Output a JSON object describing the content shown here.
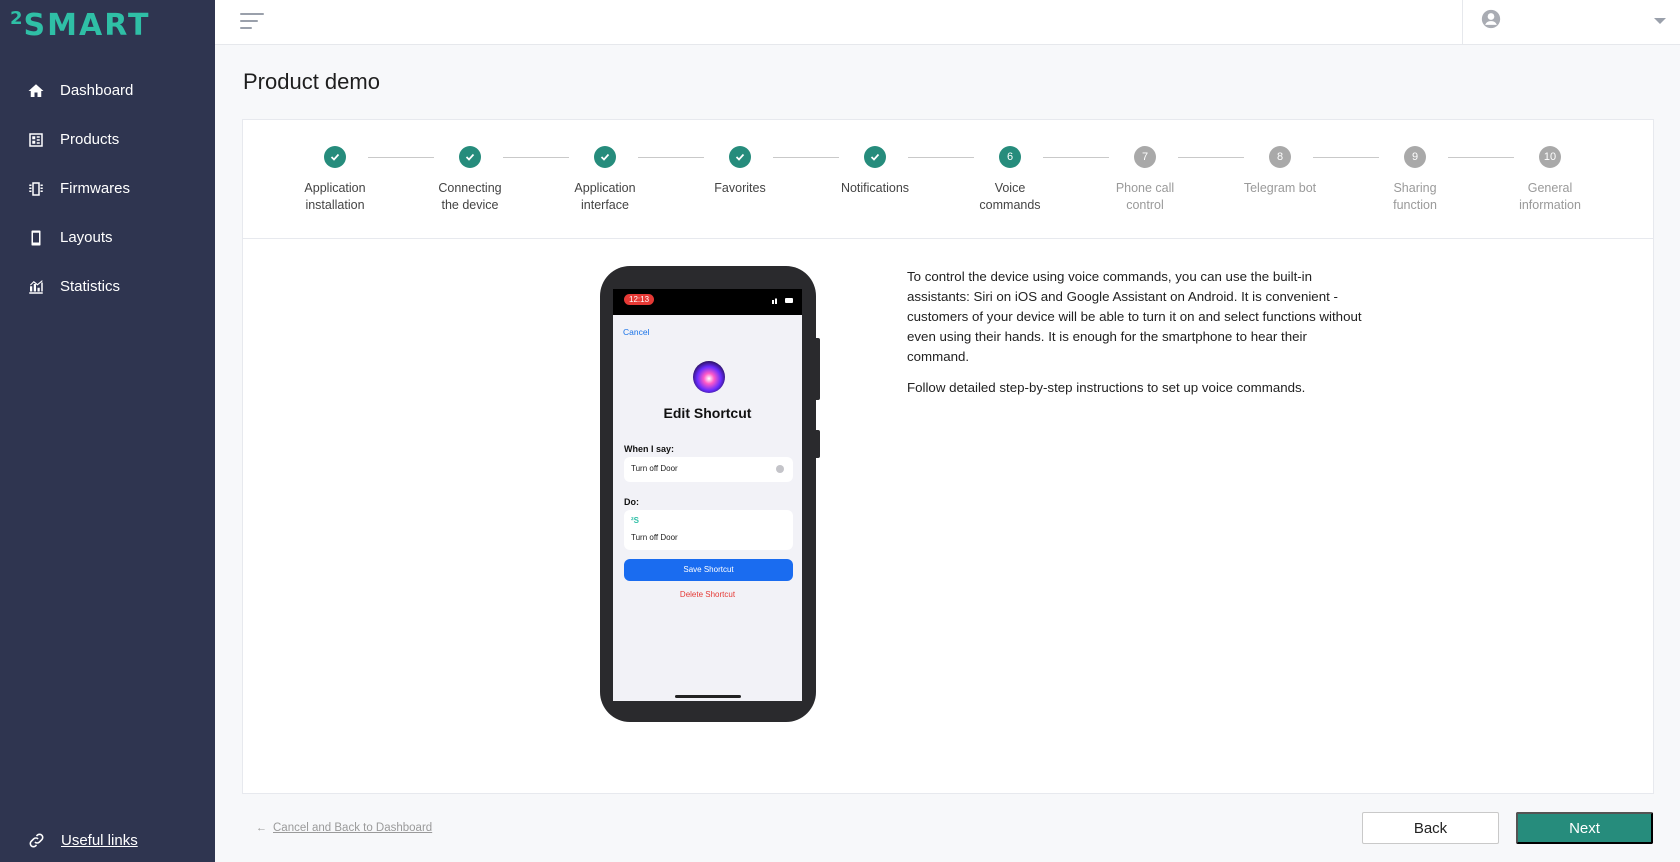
{
  "brand": {
    "logo_sup": "2",
    "logo_text": "SMART",
    "accent": "#268c7c",
    "logo_color": "#2fbfa6"
  },
  "sidebar": {
    "items": [
      {
        "label": "Dashboard",
        "icon": "home-icon"
      },
      {
        "label": "Products",
        "icon": "products-icon"
      },
      {
        "label": "Firmwares",
        "icon": "firmware-icon"
      },
      {
        "label": "Layouts",
        "icon": "phone-icon"
      },
      {
        "label": "Statistics",
        "icon": "statistics-icon"
      }
    ],
    "useful_links": "Useful links"
  },
  "header": {
    "user_icon": "user-icon",
    "menu_icon": "menu-icon"
  },
  "page": {
    "title": "Product demo"
  },
  "steps": [
    {
      "number": "1",
      "line1": "Application",
      "line2": "installation",
      "state": "done"
    },
    {
      "number": "2",
      "line1": "Connecting",
      "line2": "the device",
      "state": "done"
    },
    {
      "number": "3",
      "line1": "Application",
      "line2": "interface",
      "state": "done"
    },
    {
      "number": "4",
      "line1": "Favorites",
      "line2": "",
      "state": "done"
    },
    {
      "number": "5",
      "line1": "Notifications",
      "line2": "",
      "state": "done"
    },
    {
      "number": "6",
      "line1": "Voice",
      "line2": "commands",
      "state": "active"
    },
    {
      "number": "7",
      "line1": "Phone call",
      "line2": "control",
      "state": "todo"
    },
    {
      "number": "8",
      "line1": "Telegram bot",
      "line2": "",
      "state": "todo"
    },
    {
      "number": "9",
      "line1": "Sharing",
      "line2": "function",
      "state": "todo"
    },
    {
      "number": "10",
      "line1": "General",
      "line2": "information",
      "state": "todo"
    }
  ],
  "phone": {
    "time": "12:13",
    "cancel": "Cancel",
    "title": "Edit Shortcut",
    "when_label": "When I say:",
    "when_value": "Turn off Door",
    "do_label": "Do:",
    "do_app": "²S",
    "do_value": "Turn off Door",
    "save": "Save Shortcut",
    "delete": "Delete Shortcut"
  },
  "description": {
    "paragraph1": "To control the device using voice commands, you can use the built-in assistants: Siri on iOS and Google Assistant on Android. It is convenient - customers of your device will be able to turn it on and select functions without even using their hands. It is enough for the smartphone to hear their command.",
    "paragraph2": "Follow detailed step-by-step instructions to set up voice commands."
  },
  "footer": {
    "cancel_link": "Cancel and Back to Dashboard",
    "back": "Back",
    "next": "Next"
  }
}
